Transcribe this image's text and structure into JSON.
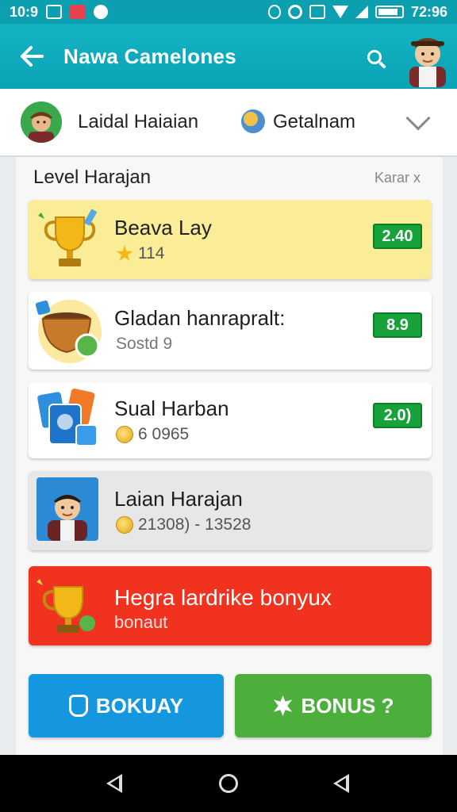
{
  "status_bar": {
    "time_left": "10:9",
    "time_right": "72:96"
  },
  "app_bar": {
    "title": "Nawa Camelones"
  },
  "filter": {
    "user_name": "Laidal Haiaian",
    "category": "Getalnam"
  },
  "panel": {
    "title": "Level Harajan",
    "link": "Karar x"
  },
  "cards": [
    {
      "name": "Beava Lay",
      "sub": "114",
      "value": "2.40",
      "icon": "trophy-icon",
      "bg": "#fbed97"
    },
    {
      "name": "Gladan hanrapralt:",
      "sub": "Sostd 9",
      "value": "8.9",
      "icon": "pot-icon",
      "bg": "#ffffff"
    },
    {
      "name": "Sual Harban",
      "sub": "6 0965",
      "value": "2.0)",
      "icon": "cards-icon",
      "bg": "#ffffff"
    },
    {
      "name": "Laian Harajan",
      "sub": "21308) - 13528",
      "icon": "person-icon",
      "bg": "#e7e7e7"
    }
  ],
  "bonus": {
    "name": "Hegra lardrike bonyux",
    "sub": "bonaut"
  },
  "buttons": {
    "left": "BOKUAY",
    "right": "BONUS ?"
  },
  "colors": {
    "accent": "#0aa3b5",
    "value_green": "#18a33a",
    "bonus_red": "#f0321e",
    "btn_blue": "#1597df",
    "btn_green": "#4caf3c"
  }
}
